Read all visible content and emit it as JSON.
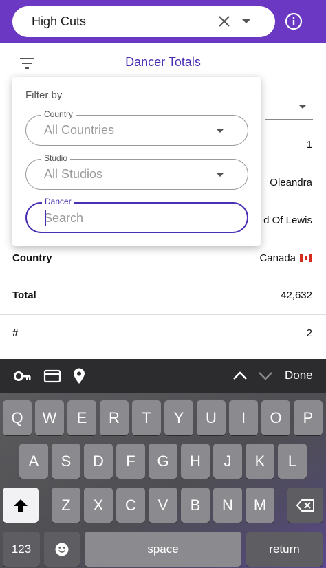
{
  "header": {
    "combo_value": "High Cuts",
    "combo_clear_icon": "close-icon",
    "combo_dropdown_icon": "dropdown-arrow-icon",
    "info_icon": "info-icon",
    "bg_color": "#6a38c2"
  },
  "subheader": {
    "filter_icon": "filter-icon",
    "title": "Dancer Totals"
  },
  "table": {
    "rows": [
      {
        "label": "",
        "value": "1"
      },
      {
        "label": "",
        "value": "Oleandra"
      },
      {
        "label": "",
        "value": "d Of Lewis"
      },
      {
        "label": "Country",
        "value": "Canada"
      },
      {
        "label": "Total",
        "value": "42,632"
      },
      {
        "label": "#",
        "value": "2"
      }
    ]
  },
  "filter_popup": {
    "title": "Filter by",
    "country": {
      "label": "Country",
      "value": "All Countries"
    },
    "studio": {
      "label": "Studio",
      "value": "All Studios"
    },
    "dancer": {
      "label": "Dancer",
      "placeholder": "Search",
      "value": ""
    }
  },
  "keyboard_bar": {
    "icons": [
      "key-icon",
      "credit-card-icon",
      "location-pin-icon"
    ],
    "done": "Done"
  },
  "keyboard": {
    "row1": [
      "Q",
      "W",
      "E",
      "R",
      "T",
      "Y",
      "U",
      "I",
      "O",
      "P"
    ],
    "row2": [
      "A",
      "S",
      "D",
      "F",
      "G",
      "H",
      "J",
      "K",
      "L"
    ],
    "row3": [
      "Z",
      "X",
      "C",
      "V",
      "B",
      "N",
      "M"
    ],
    "numbers_key": "123",
    "space_key": "space",
    "return_key": "return"
  },
  "colors": {
    "accent": "#4a2fb4",
    "appbar": "#6a38c2"
  }
}
